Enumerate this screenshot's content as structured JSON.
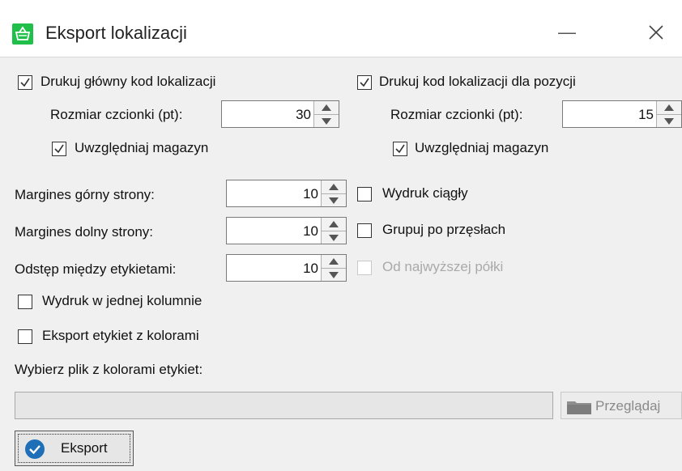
{
  "window": {
    "title": "Eksport lokalizacji",
    "minimize_glyph": "—",
    "close_glyph": "✕",
    "icon": "basket-icon",
    "accent_color": "#1fbf4a"
  },
  "main_code": {
    "checkbox_label": "Drukuj główny kod lokalizacji",
    "checked": true,
    "font_size_label": "Rozmiar czcionki (pt):",
    "font_size_value": "30",
    "include_warehouse_label": "Uwzględniaj magazyn",
    "include_warehouse_checked": true
  },
  "position_code": {
    "checkbox_label": "Drukuj kod lokalizacji dla pozycji",
    "checked": true,
    "font_size_label": "Rozmiar czcionki (pt):",
    "font_size_value": "15",
    "include_warehouse_label": "Uwzględniaj magazyn",
    "include_warehouse_checked": true
  },
  "margins": {
    "top_label": "Margines górny strony:",
    "top_value": "10",
    "bottom_label": "Margines dolny strony:",
    "bottom_value": "10",
    "gap_label": "Odstęp między etykietami:",
    "gap_value": "10"
  },
  "options": {
    "continuous_print": "Wydruk ciągły",
    "continuous_checked": false,
    "group_by_span": "Grupuj po przęsłach",
    "group_checked": false,
    "from_highest_shelf": "Od najwyższej półki",
    "from_highest_enabled": false,
    "single_column": "Wydruk w jednej kolumnie",
    "single_column_checked": false,
    "export_with_colors": "Eksport etykiet z kolorami",
    "export_with_colors_checked": false
  },
  "color_file": {
    "label": "Wybierz plik z kolorami etykiet:",
    "value": "",
    "browse_label": "Przeglądaj",
    "browse_icon": "folder-icon"
  },
  "footer": {
    "export_label": "Eksport",
    "export_icon": "check-circle-icon",
    "export_icon_color": "#1e6fb8"
  }
}
